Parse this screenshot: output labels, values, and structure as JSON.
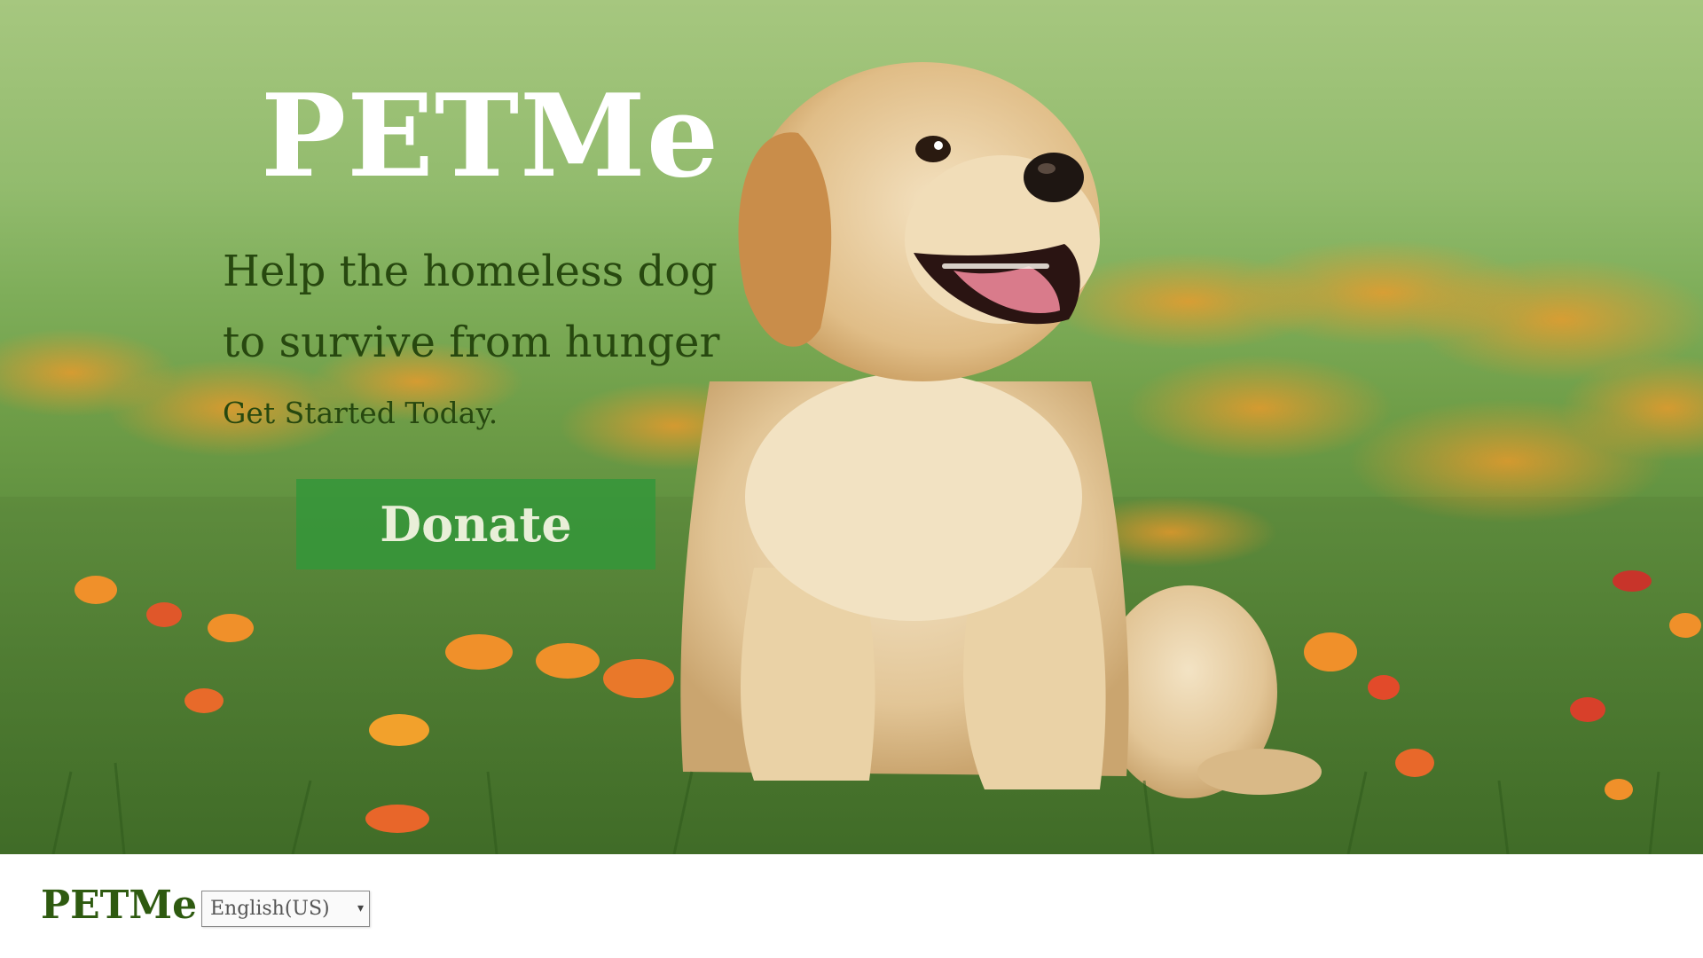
{
  "hero": {
    "title": "PETMe",
    "tagline": "Help the homeless dog to survive from hunger",
    "subtitle": "Get Started Today.",
    "donate_label": "Donate",
    "image": "puppy-in-flower-field"
  },
  "footer": {
    "logo": "PETMe",
    "language": {
      "selected": "English(US)",
      "arrow_icon": "▾"
    }
  },
  "colors": {
    "headline_text": "#27480f",
    "donate_button": "#34963a",
    "footer_logo": "#2e5a10"
  }
}
